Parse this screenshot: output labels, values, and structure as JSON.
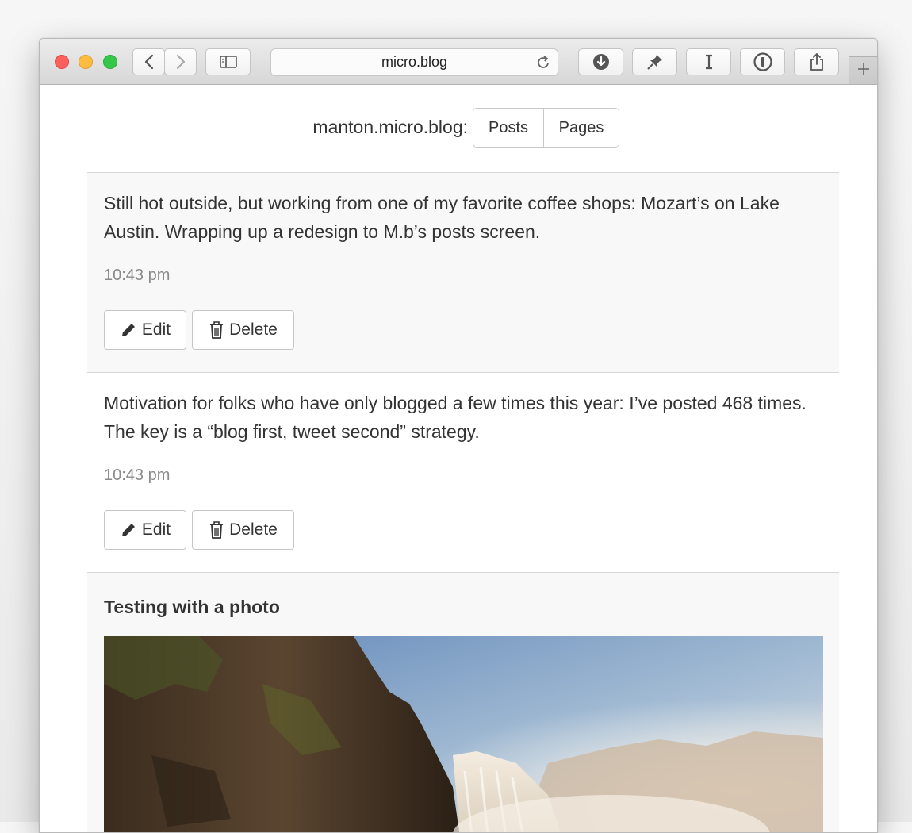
{
  "browser": {
    "address_url": "micro.blog",
    "icons": [
      "back-icon",
      "forward-icon",
      "sidebar-icon",
      "reload-icon",
      "download-icon",
      "pin-icon",
      "instapaper-icon",
      "1password-icon",
      "share-icon",
      "new-tab-icon"
    ]
  },
  "site": {
    "name": "manton.micro.blog:",
    "tabs": [
      {
        "label": "Posts"
      },
      {
        "label": "Pages"
      }
    ]
  },
  "posts": [
    {
      "text": "Still hot outside, but working from one of my favorite coffee shops: Mozart’s on Lake Austin. Wrapping up a redesign to M.b’s posts screen.",
      "time": "10:43 pm",
      "edit_label": "Edit",
      "delete_label": "Delete"
    },
    {
      "text": "Motivation for folks who have only blogged a few times this year: I’ve posted 468 times. The key is a “blog first, tweet second” strategy.",
      "time": "10:43 pm",
      "edit_label": "Edit",
      "delete_label": "Delete"
    },
    {
      "title": "Testing with a photo"
    }
  ],
  "colors": {
    "post_alt_bg": "#f8f8f8",
    "time_text": "#8a8a8a",
    "border": "#d6d6d6"
  }
}
